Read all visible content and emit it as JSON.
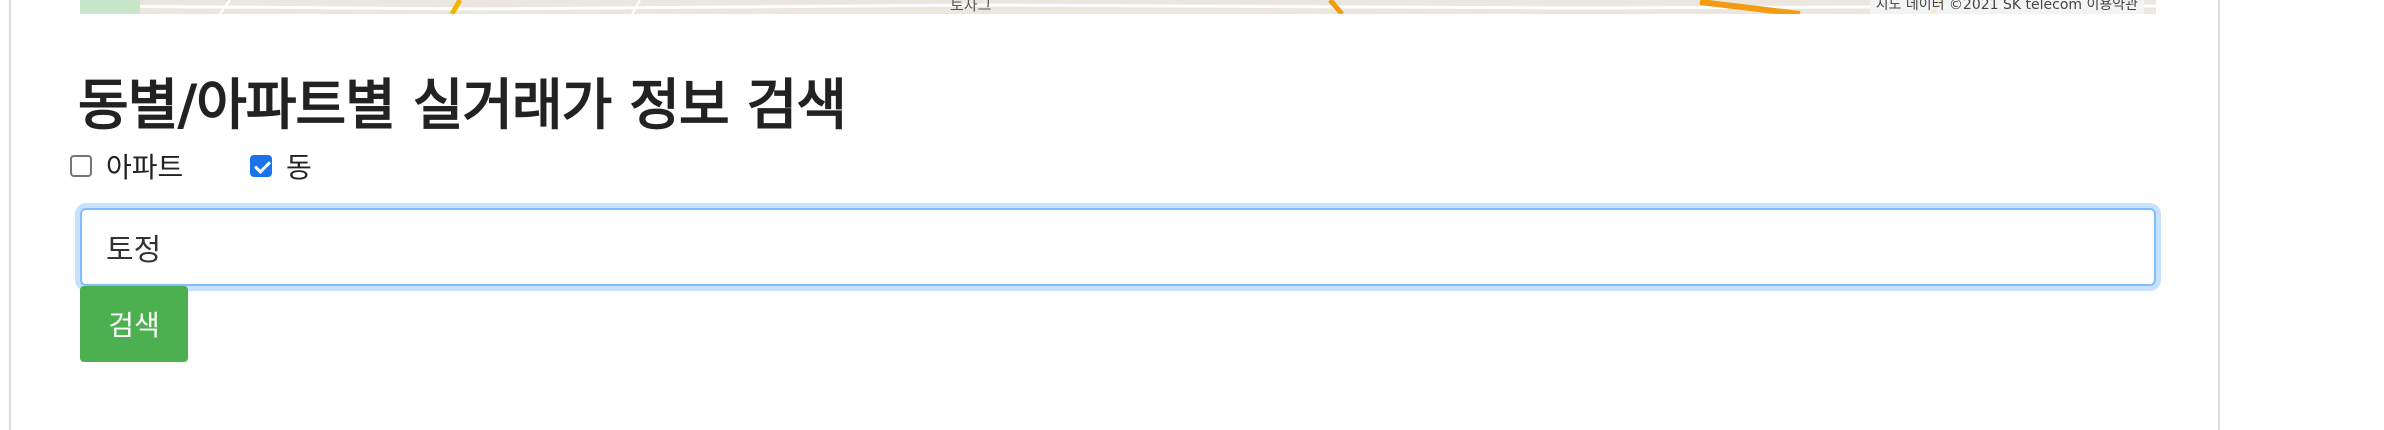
{
  "map": {
    "place_label": "토자그",
    "attribution": "지도 데이터 ©2021 SK telecom   이용약관"
  },
  "section": {
    "title": "동별/아파트별 실거래가 정보 검색"
  },
  "filters": {
    "apartment_label": "아파트",
    "apartment_checked": false,
    "dong_label": "동",
    "dong_checked": true
  },
  "search": {
    "value": "토정",
    "button_label": "검색"
  },
  "colors": {
    "button": "#4caf50",
    "checkbox_checked": "#1a73e8",
    "input_focus": "#80bdff"
  }
}
